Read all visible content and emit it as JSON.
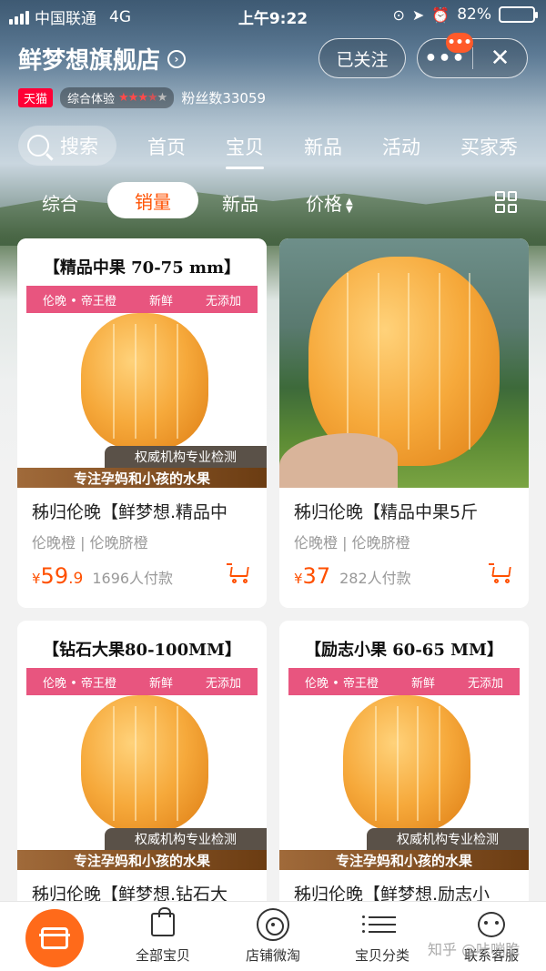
{
  "status_bar": {
    "carrier": "中国联通",
    "network": "4G",
    "time": "上午9:22",
    "battery": "82%",
    "battery_level": 0.82,
    "battery_color": "#4cd964"
  },
  "store": {
    "name": "鲜梦想旗舰店",
    "follow_label": "已关注",
    "more_label": "•••",
    "close_label": "✕",
    "notif_badge": "•••",
    "tmall_badge": "天猫",
    "experience_label": "综合体验",
    "rating_stars": 3.5,
    "fans_label": "粉丝数33059"
  },
  "nav": {
    "search_label": "搜索",
    "tabs": [
      {
        "label": "首页"
      },
      {
        "label": "宝贝"
      },
      {
        "label": "新品"
      },
      {
        "label": "活动"
      },
      {
        "label": "买家秀"
      }
    ],
    "active_tab": "宝贝"
  },
  "sort": {
    "options": [
      "综合",
      "销量",
      "新品",
      "价格"
    ],
    "active": "销量",
    "accent_color": "#ff5000"
  },
  "products": [
    {
      "promo_title": "【精品中果 70-75 mm】",
      "band_texts": [
        "伦晚 • 帝王橙",
        "新鲜",
        "无添加"
      ],
      "cert_text": "权威机构专业检测",
      "mom_text": "专注孕妈和小孩的水果",
      "title": "秭归伦晚【鲜梦想.精品中",
      "tags": "伦晚橙 | 伦晚脐橙",
      "currency": "¥",
      "price_int": "59",
      "price_dec": ".9",
      "sold": "1696人付款"
    },
    {
      "photo": true,
      "title": "秭归伦晚【精品中果5斤",
      "tags": "伦晚橙 | 伦晚脐橙",
      "currency": "¥",
      "price_int": "37",
      "price_dec": "",
      "sold": "282人付款"
    },
    {
      "promo_title": "【钻石大果80-100MM】",
      "band_texts": [
        "伦晚 • 帝王橙",
        "新鲜",
        "无添加"
      ],
      "cert_text": "权威机构专业检测",
      "mom_text": "专注孕妈和小孩的水果",
      "title": "秭归伦晚【鲜梦想.钻石大",
      "tags": "",
      "currency": "",
      "price_int": "",
      "price_dec": "",
      "sold": ""
    },
    {
      "promo_title": "【励志小果 60-65 MM】",
      "band_texts": [
        "伦晚 • 帝王橙",
        "新鲜",
        "无添加"
      ],
      "cert_text": "权威机构专业检测",
      "mom_text": "专注孕妈和小孩的水果",
      "title": "秭归伦晚【鲜梦想.励志小",
      "tags": "",
      "currency": "",
      "price_int": "",
      "price_dec": "",
      "sold": ""
    }
  ],
  "bottom_bar": {
    "items": [
      {
        "label": "全部宝贝",
        "icon": "shopping-bag-icon"
      },
      {
        "label": "店铺微淘",
        "icon": "live-broadcast-icon"
      },
      {
        "label": "宝贝分类",
        "icon": "category-list-icon"
      },
      {
        "label": "联系客服",
        "icon": "customer-service-icon"
      }
    ],
    "home_icon": "store-home-icon"
  },
  "watermark": "知乎 @咔嘣脆"
}
